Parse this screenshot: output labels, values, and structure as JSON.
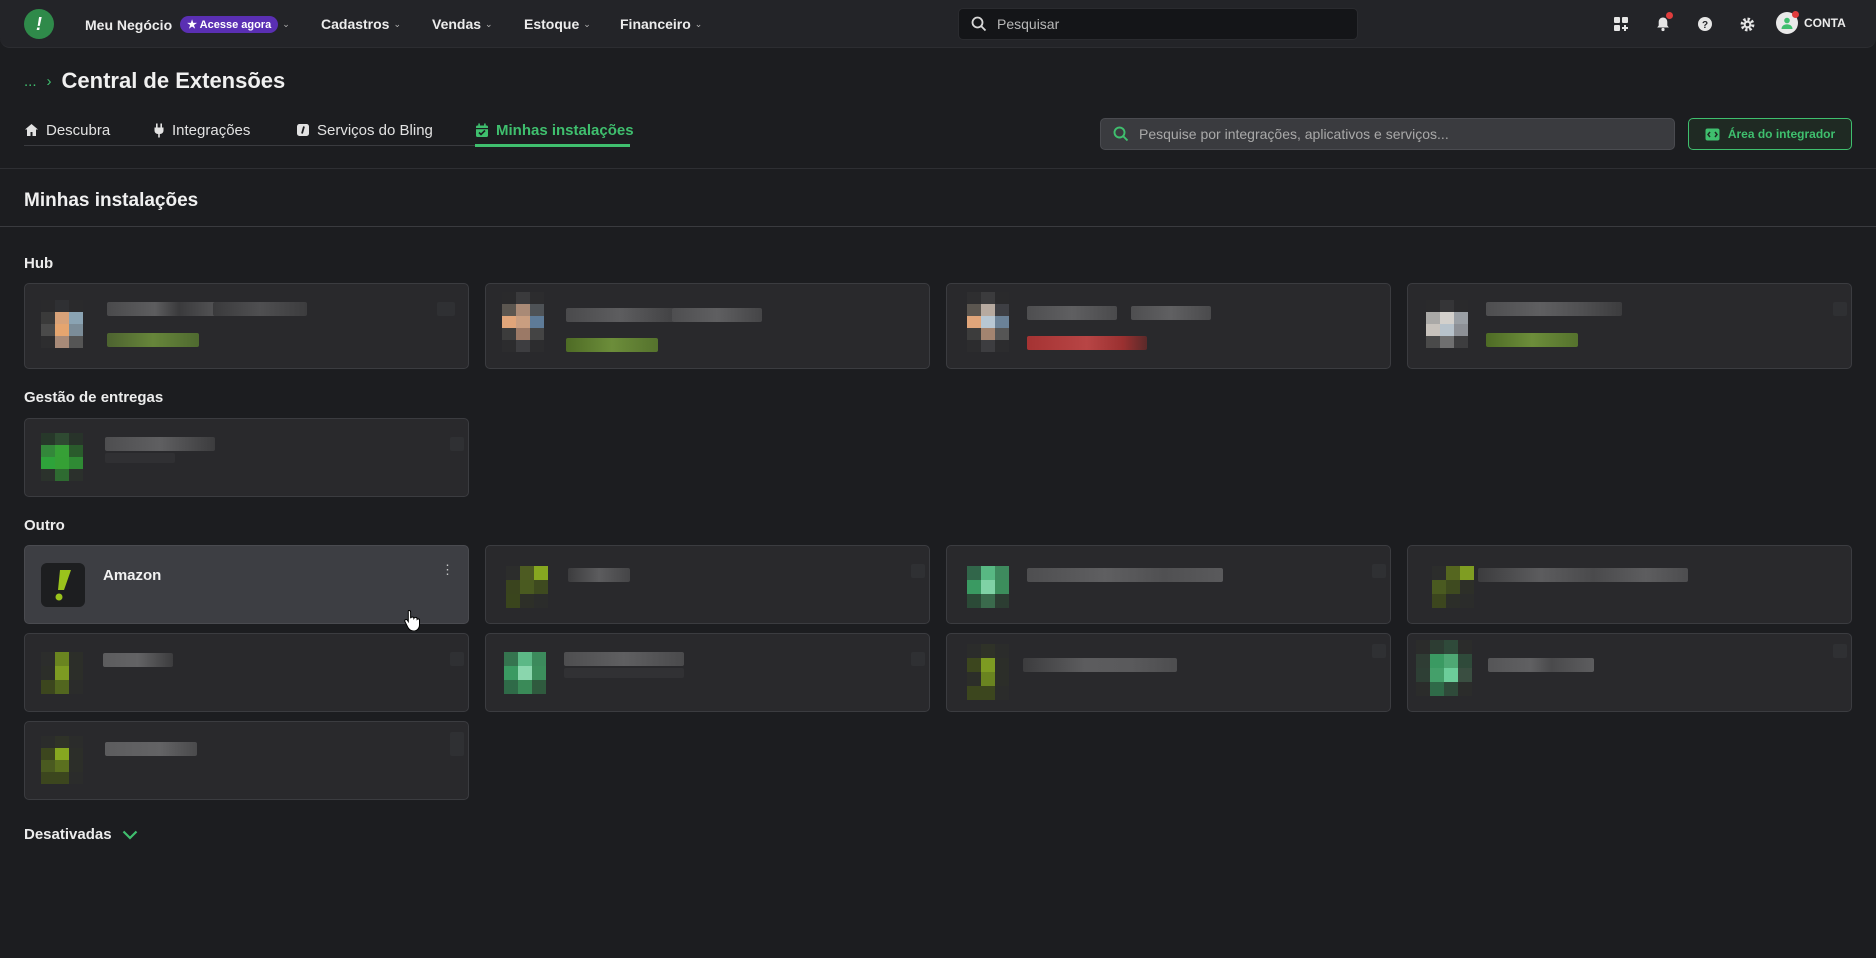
{
  "topbar": {
    "logo_letter": "!",
    "business": {
      "label": "Meu Negócio",
      "promo_badge": "Acesse agora"
    },
    "menu": [
      {
        "label": "Cadastros"
      },
      {
        "label": "Vendas"
      },
      {
        "label": "Estoque"
      },
      {
        "label": "Financeiro"
      }
    ],
    "search_placeholder": "Pesquisar",
    "account_label": "CONTA"
  },
  "header": {
    "breadcrumb_more": "...",
    "breadcrumb_sep": "›",
    "title": "Central de Extensões",
    "tabs": [
      {
        "label": "Descubra",
        "icon": "home-icon",
        "active": false
      },
      {
        "label": "Integrações",
        "icon": "plug-icon",
        "active": false
      },
      {
        "label": "Serviços do Bling",
        "icon": "bling-services-icon",
        "active": false
      },
      {
        "label": "Minhas instalações",
        "icon": "calendar-check-icon",
        "active": true
      }
    ],
    "extension_search_placeholder": "Pesquise por integrações, aplicativos e serviços...",
    "integrator_button": "Área do integrador"
  },
  "main": {
    "heading": "Minhas instalações",
    "groups": [
      {
        "title": "Hub",
        "cards": 4
      },
      {
        "title": "Gestão de entregas",
        "cards": 1
      },
      {
        "title": "Outro",
        "cards": 9,
        "visible_card_name": "Amazon"
      }
    ],
    "disabled_section": "Desativadas"
  },
  "colors": {
    "accent": "#3fbf6e",
    "background": "#1c1d20",
    "topbar": "#232428",
    "card": "#29292c",
    "promo": "#5a2fb3",
    "notification": "#e03c3c"
  }
}
